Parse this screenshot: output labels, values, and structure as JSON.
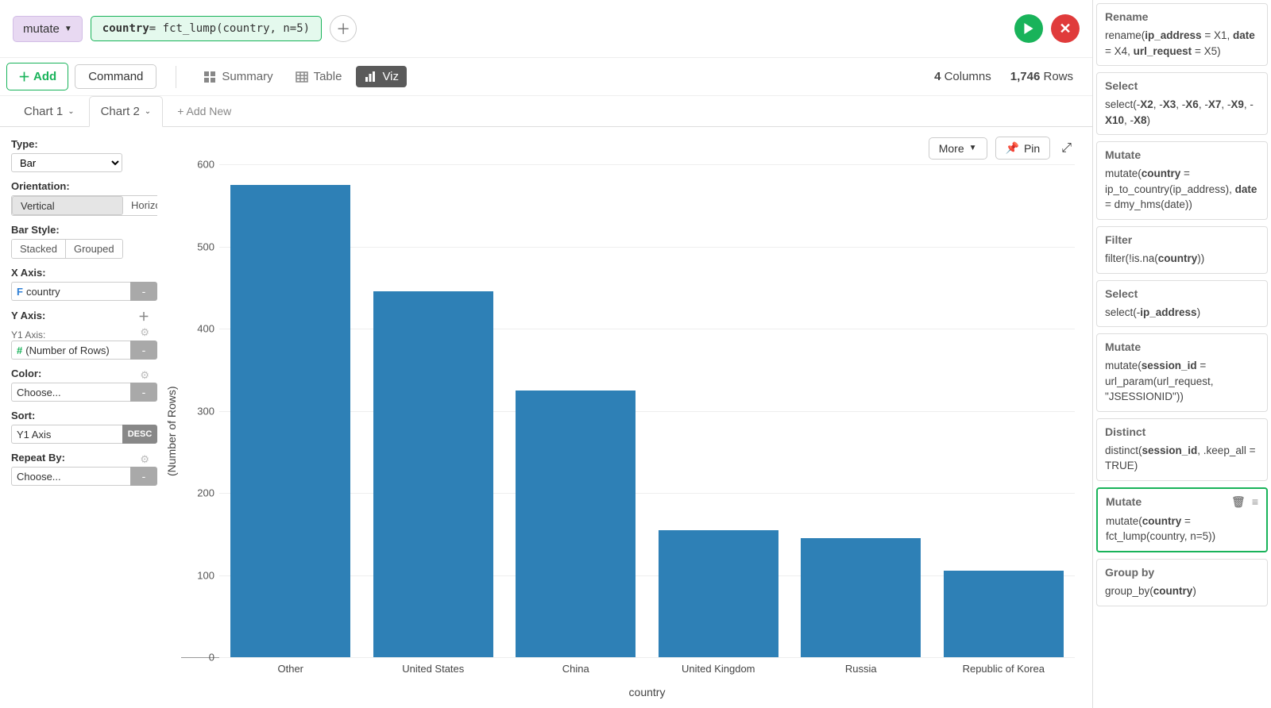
{
  "header": {
    "mutate_label": "mutate",
    "formula_var": "country",
    "formula_eq": " = fct_lump(country, n=5)"
  },
  "toolbar": {
    "add_label": "Add",
    "command_label": "Command",
    "summary_label": "Summary",
    "table_label": "Table",
    "viz_label": "Viz",
    "columns_count": "4",
    "columns_word": "Columns",
    "rows_count": "1,746",
    "rows_word": "Rows"
  },
  "tabs": {
    "chart1": "Chart 1",
    "chart2": "Chart 2",
    "add_new": "+ Add New"
  },
  "controls": {
    "type_label": "Type:",
    "type_value": "Bar",
    "orientation_label": "Orientation:",
    "orientation_vertical": "Vertical",
    "orientation_horizontal": "Horizontal",
    "bar_style_label": "Bar Style:",
    "stacked": "Stacked",
    "grouped": "Grouped",
    "x_axis_label": "X Axis:",
    "x_field": "country",
    "y_axis_label": "Y Axis:",
    "y1_axis_label": "Y1 Axis:",
    "y1_field": "(Number of Rows)",
    "color_label": "Color:",
    "choose": "Choose...",
    "sort_label": "Sort:",
    "sort_value": "Y1 Axis",
    "sort_dir": "DESC",
    "repeat_label": "Repeat By:"
  },
  "chart_top": {
    "more": "More",
    "pin": "Pin"
  },
  "chart_data": {
    "type": "bar",
    "categories": [
      "Other",
      "United States",
      "China",
      "United Kingdom",
      "Russia",
      "Republic of Korea"
    ],
    "values": [
      575,
      445,
      325,
      155,
      145,
      105
    ],
    "title": "",
    "xlabel": "country",
    "ylabel": "(Number of Rows)",
    "ylim": [
      0,
      600
    ],
    "yticks": [
      0,
      100,
      200,
      300,
      400,
      500,
      600
    ]
  },
  "steps": [
    {
      "title": "Rename",
      "code_parts": [
        "rename(",
        {
          "b": "ip_address"
        },
        " = X1, ",
        {
          "b": "date"
        },
        " = X4, ",
        {
          "b": "url_request"
        },
        " = X5)"
      ]
    },
    {
      "title": "Select",
      "code_parts": [
        "select(-",
        {
          "b": "X2"
        },
        ", -",
        {
          "b": "X3"
        },
        ", -",
        {
          "b": "X6"
        },
        ", -",
        {
          "b": "X7"
        },
        ", -",
        {
          "b": "X9"
        },
        ", -",
        {
          "b": "X10"
        },
        ", -",
        {
          "b": "X8"
        },
        ")"
      ]
    },
    {
      "title": "Mutate",
      "code_parts": [
        "mutate(",
        {
          "b": "country"
        },
        " = ip_to_country(ip_address), ",
        {
          "b": "date"
        },
        " = dmy_hms(date))"
      ]
    },
    {
      "title": "Filter",
      "code_parts": [
        "filter(!is.na(",
        {
          "b": "country"
        },
        "))"
      ]
    },
    {
      "title": "Select",
      "code_parts": [
        "select(-",
        {
          "b": "ip_address"
        },
        ")"
      ]
    },
    {
      "title": "Mutate",
      "code_parts": [
        "mutate(",
        {
          "b": "session_id"
        },
        " = url_param(url_request, \"JSESSIONID\"))"
      ]
    },
    {
      "title": "Distinct",
      "code_parts": [
        "distinct(",
        {
          "b": "session_id"
        },
        ", .keep_all = TRUE)"
      ]
    },
    {
      "title": "Mutate",
      "code_parts": [
        "mutate(",
        {
          "b": "country"
        },
        " = fct_lump(country, n=5))"
      ],
      "active": true,
      "icons": true
    },
    {
      "title": "Group by",
      "code_parts": [
        "group_by(",
        {
          "b": "country"
        },
        ")"
      ]
    }
  ]
}
